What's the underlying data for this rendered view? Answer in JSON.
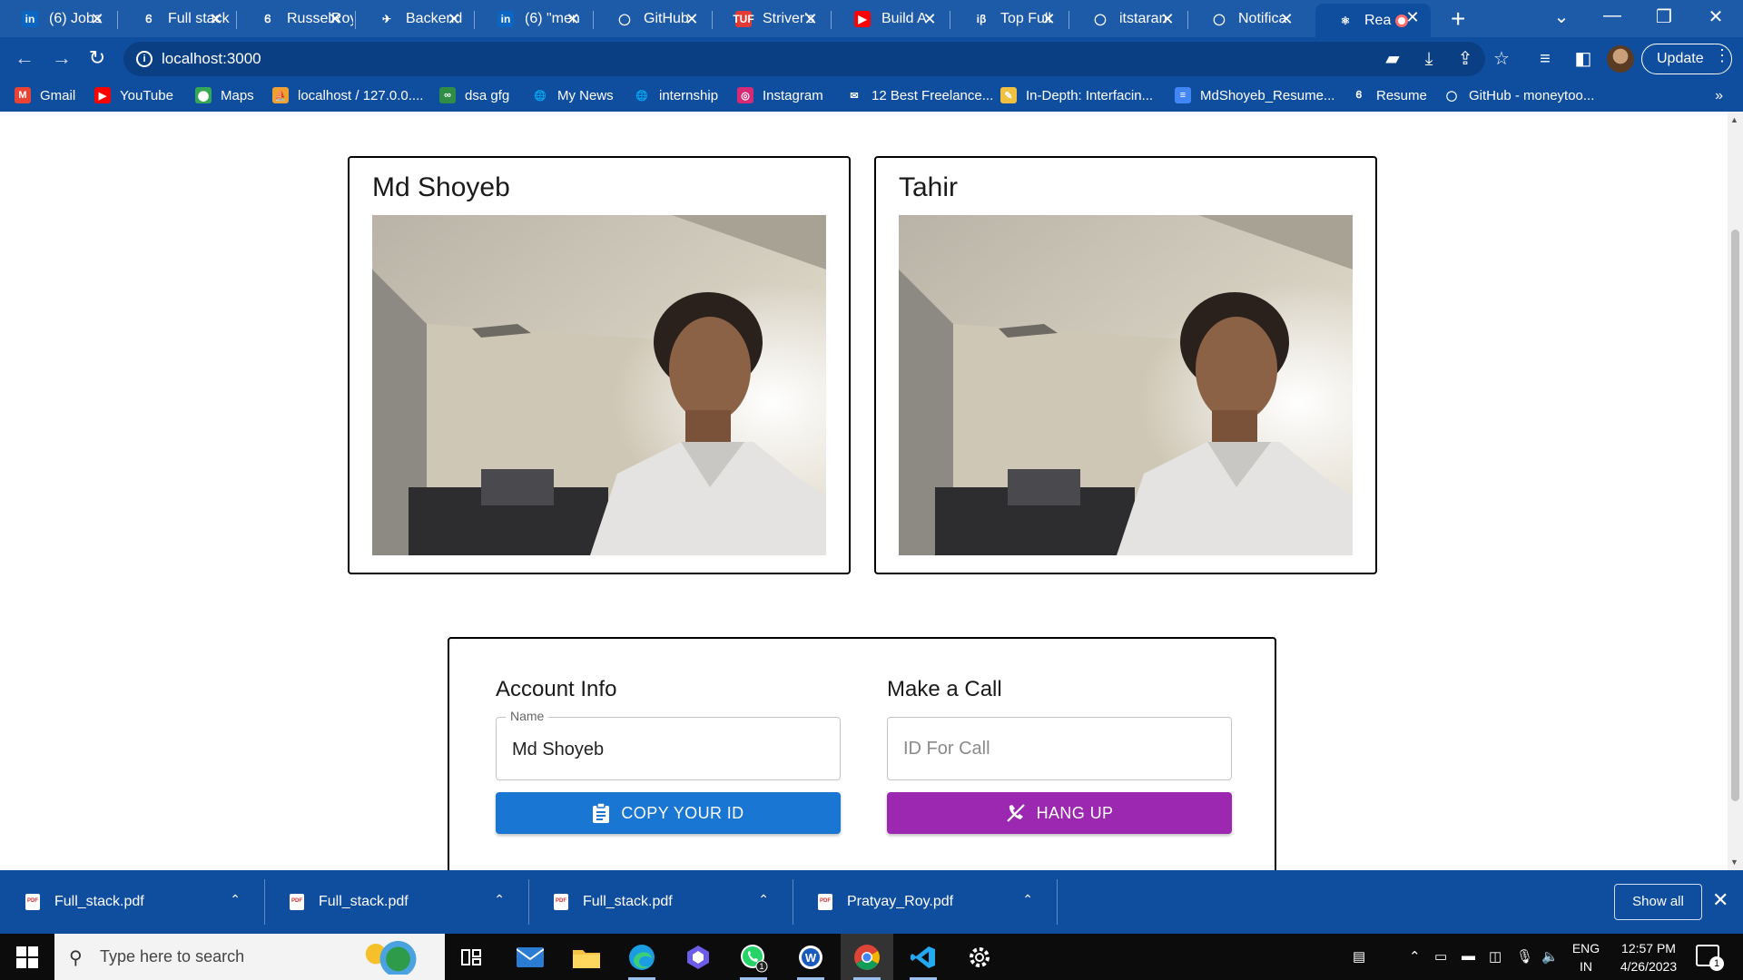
{
  "browser": {
    "tabs": [
      {
        "title": "(6) Jobs",
        "icon": "linkedin-icon",
        "color": "#0a66c2",
        "glyph": "in"
      },
      {
        "title": "Full stack",
        "icon": "sprout-icon",
        "color": "#1d5aa8",
        "glyph": "Ꮾ"
      },
      {
        "title": "RusselRoy",
        "icon": "sprout-icon",
        "color": "#1d5aa8",
        "glyph": "Ꮾ"
      },
      {
        "title": "Backend",
        "icon": "runner-icon",
        "color": "#1d5aa8",
        "glyph": "✈"
      },
      {
        "title": "(6) \"men",
        "icon": "linkedin-icon",
        "color": "#0a66c2",
        "glyph": "in"
      },
      {
        "title": "GitHub",
        "icon": "github-icon",
        "color": "#1d5aa8",
        "glyph": "◯"
      },
      {
        "title": "Striver's",
        "icon": "tuf-icon",
        "color": "#e53935",
        "glyph": "TUF"
      },
      {
        "title": "Build A",
        "icon": "youtube-icon",
        "color": "#ff0000",
        "glyph": "▶"
      },
      {
        "title": "Top Full",
        "icon": "interviewbit-icon",
        "color": "#1d5aa8",
        "glyph": "iβ"
      },
      {
        "title": "itstaran",
        "icon": "github-icon",
        "color": "#1d5aa8",
        "glyph": "◯"
      },
      {
        "title": "Notifica",
        "icon": "github-icon",
        "color": "#1d5aa8",
        "glyph": "◯"
      },
      {
        "title": "Rea",
        "icon": "react-icon",
        "color": "#0f4e9e",
        "glyph": "⚛"
      }
    ],
    "url": "localhost:3000",
    "update_label": "Update",
    "bookmarks": [
      {
        "label": "Gmail",
        "icon": "gmail-icon",
        "color": "#ea4335",
        "glyph": "M"
      },
      {
        "label": "YouTube",
        "icon": "youtube-icon",
        "color": "#ff0000",
        "glyph": "▶"
      },
      {
        "label": "Maps",
        "icon": "maps-icon",
        "color": "#34a853",
        "glyph": "⬤"
      },
      {
        "label": "localhost / 127.0.0....",
        "icon": "phpmyadmin-icon",
        "color": "#f0a030",
        "glyph": "⛵"
      },
      {
        "label": "dsa gfg",
        "icon": "gfg-icon",
        "color": "#2f8d46",
        "glyph": "∞"
      },
      {
        "label": "My News",
        "icon": "globe-icon",
        "color": "#ffffff",
        "glyph": "🌐"
      },
      {
        "label": "internship",
        "icon": "globe-icon",
        "color": "#ffffff",
        "glyph": "🌐"
      },
      {
        "label": "Instagram",
        "icon": "instagram-icon",
        "color": "#d62976",
        "glyph": "◎"
      },
      {
        "label": "12 Best Freelance...",
        "icon": "bookmark-icon",
        "color": "#1d5aa8",
        "glyph": "✉"
      },
      {
        "label": "In-Depth: Interfacin...",
        "icon": "bookmark-icon",
        "color": "#f0c040",
        "glyph": "✎"
      },
      {
        "label": "MdShoyeb_Resume...",
        "icon": "docs-icon",
        "color": "#4285f4",
        "glyph": "≡"
      },
      {
        "label": "Resume",
        "icon": "sprout-icon",
        "color": "#1d5aa8",
        "glyph": "Ꮾ"
      },
      {
        "label": "GitHub - moneytoo...",
        "icon": "github-icon",
        "color": "#1d5aa8",
        "glyph": "◯"
      }
    ]
  },
  "videos": {
    "local_name": "Md Shoyeb",
    "remote_name": "Tahir"
  },
  "options": {
    "account_title": "Account Info",
    "name_label": "Name",
    "name_value": "Md Shoyeb",
    "copy_label": "COPY YOUR ID",
    "call_title": "Make a Call",
    "call_placeholder": "ID For Call",
    "hangup_label": "HANG UP"
  },
  "downloads": {
    "items": [
      "Full_stack.pdf",
      "Full_stack.pdf",
      "Full_stack.pdf",
      "Pratyay_Roy.pdf"
    ],
    "show_all": "Show all"
  },
  "taskbar": {
    "search_placeholder": "Type here to search",
    "lang_top": "ENG",
    "lang_bottom": "IN",
    "time": "12:57 PM",
    "date": "4/26/2023",
    "whatsapp_badge": "1",
    "notification_count": "1"
  },
  "colors": {
    "chrome_blue": "#0f4e9e",
    "copy_button": "#1976d2",
    "hangup_button": "#9c27b0"
  }
}
